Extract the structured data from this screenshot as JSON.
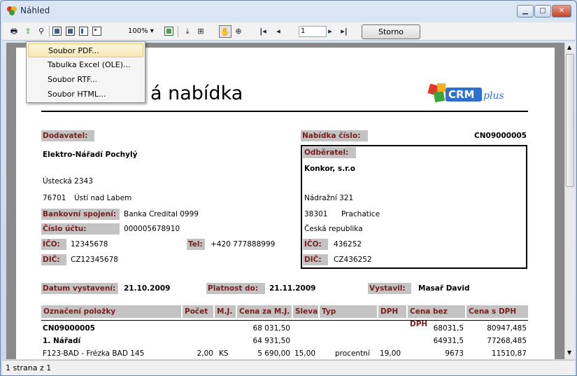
{
  "window": {
    "title": "Náhled"
  },
  "toolbar": {
    "zoom": "100%",
    "page_input": "1",
    "storno_label": "Storno"
  },
  "export_menu": {
    "items": [
      {
        "label": "Soubor PDF..."
      },
      {
        "label": "Tabulka Excel (OLE)..."
      },
      {
        "label": "Soubor RTF..."
      },
      {
        "label": "Soubor HTML..."
      }
    ]
  },
  "status": {
    "text": "1 strana z 1"
  },
  "document": {
    "title_visible": "á nabídka",
    "logo_text": "CRMplus",
    "supplier_label": "Dodavatel:",
    "supplier_name": "Elektro-Nářadí Pochylý",
    "supplier_street": "Ústecká 2343",
    "supplier_zip": "76701",
    "supplier_city": "Ústí nad Labem",
    "bank_label": "Bankovní spojení:",
    "bank_value": "Banka Credital 0999",
    "account_label": "Číslo účtu:",
    "account_value": "000005678910",
    "ico_label": "IČO:",
    "ico_value": "12345678",
    "dic_label": "DIČ:",
    "dic_value": "CZ12345678",
    "tel_label": "Tel:",
    "tel_value": "+420 777888999",
    "offer_label": "Nabídka číslo:",
    "offer_value": "CN09000005",
    "customer_label": "Odběratel:",
    "customer_name": "Konkor, s.r.o",
    "customer_street": "Nádražní 321",
    "customer_zip": "38301",
    "customer_city": "Prachatice",
    "customer_country": "Česká republika",
    "customer_ico_label": "IČO:",
    "customer_ico": "436252",
    "customer_dic_label": "DIČ:",
    "customer_dic": "CZ436252",
    "date_label": "Datum vystavení:",
    "date_value": "21.10.2009",
    "valid_label": "Platnost do:",
    "valid_value": "21.11.2009",
    "issued_label": "Vystavil:",
    "issued_value": "Masař David"
  },
  "table": {
    "headers": [
      "Označení položky",
      "Počet",
      "M.J.",
      "Cena za M.J.",
      "Sleva",
      "Typ",
      "DPH",
      "Cena bez DPH",
      "Cena s DPH"
    ],
    "rows": [
      [
        "CN09000005",
        "",
        "",
        "68 031,50",
        "",
        "",
        "",
        "68031,5",
        "80947,485"
      ],
      [
        "1. Nářadí",
        "",
        "",
        "64 931,50",
        "",
        "",
        "",
        "64931,5",
        "77268,485"
      ],
      [
        "F123-BAD - Frézka BAD 145",
        "2,00",
        "KS",
        "5 690,00",
        "15,00",
        "procentní",
        "19,00",
        "9673",
        "11510,87"
      ]
    ]
  }
}
